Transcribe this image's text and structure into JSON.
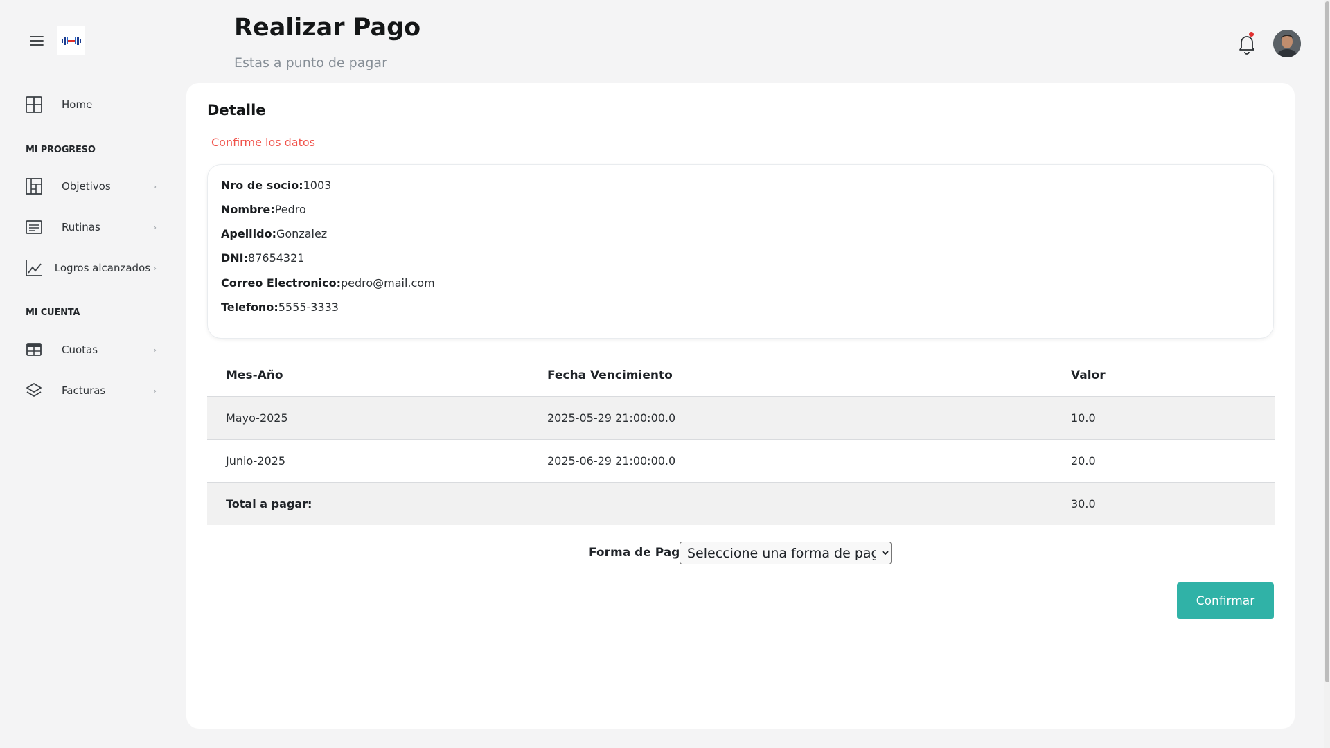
{
  "header": {
    "title": "Realizar Pago",
    "subtitle": "Estas a punto de pagar"
  },
  "sidebar": {
    "home": "Home",
    "section_progress": "MI PROGRESO",
    "objetivos": "Objetivos",
    "rutinas": "Rutinas",
    "logros": "Logros alcanzados",
    "section_account": "MI CUENTA",
    "cuotas": "Cuotas",
    "facturas": "Facturas",
    "chevron": "›"
  },
  "detail": {
    "title": "Detalle",
    "hint": "Confirme los datos",
    "socio_label": "Nro de socio:",
    "socio_value": "1003",
    "nombre_label": "Nombre:",
    "nombre_value": "Pedro",
    "apellido_label": "Apellido:",
    "apellido_value": "Gonzalez",
    "dni_label": "DNI:",
    "dni_value": "87654321",
    "correo_label": "Correo Electronico:",
    "correo_value": "pedro@mail.com",
    "telefono_label": "Telefono:",
    "telefono_value": "5555-3333"
  },
  "table": {
    "columns": [
      "Mes-Año",
      "Fecha Vencimiento",
      "Valor"
    ],
    "rows": [
      [
        "Mayo-2025",
        "2025-05-29 21:00:00.0",
        "10.0"
      ],
      [
        "Junio-2025",
        "2025-06-29 21:00:00.0",
        "20.0"
      ]
    ],
    "total_label": "Total a pagar:",
    "total_value": "30.0"
  },
  "payment": {
    "label": "Forma de Pago:",
    "selected": "Seleccione una forma de pago"
  },
  "actions": {
    "confirm": "Confirmar"
  },
  "colors": {
    "accent": "#30b2a7",
    "hint": "#f0534b",
    "notification": "#e03131"
  }
}
